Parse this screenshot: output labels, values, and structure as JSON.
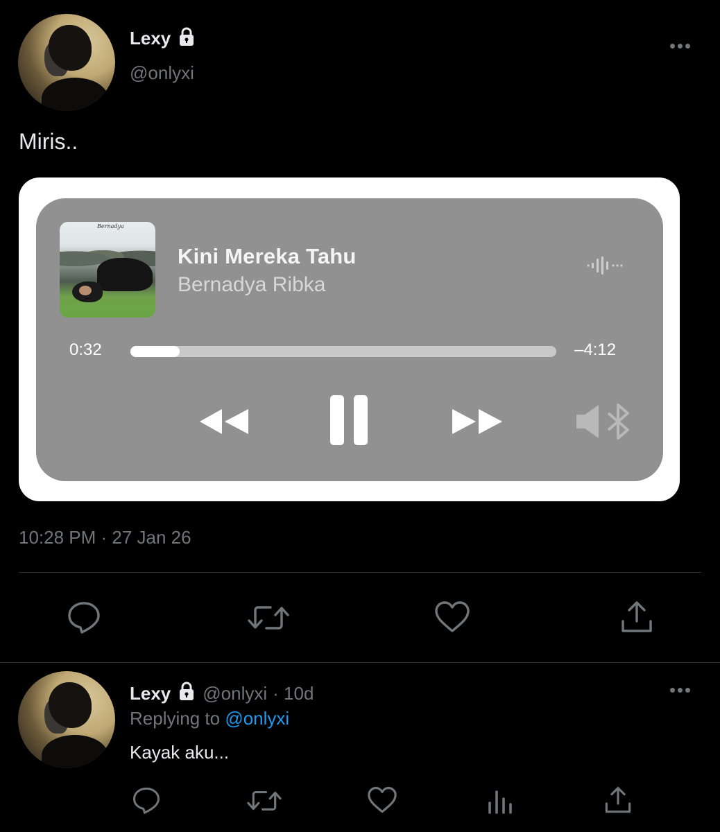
{
  "tweet": {
    "display_name": "Lexy",
    "handle": "@onlyxi",
    "text": "Miris..",
    "timestamp": "10:28 PM · 27 Jan 26",
    "actions": [
      "reply-icon",
      "retweet-icon",
      "like-icon",
      "share-icon"
    ]
  },
  "player": {
    "album_caption": "Bernadya",
    "title": "Kini Mereka Tahu",
    "artist": "Bernadya Ribka",
    "elapsed": "0:32",
    "remaining": "–4:12",
    "progress_fraction": 0.115,
    "controls": [
      "rewind-icon",
      "pause-icon",
      "fast-forward-icon",
      "bluetooth-speaker-icon"
    ]
  },
  "reply": {
    "display_name": "Lexy",
    "handle": "@onlyxi",
    "age": "· 10d",
    "replying_prefix": "Replying to",
    "replying_to": "@onlyxi",
    "text": "Kayak aku...",
    "actions": [
      "reply-icon",
      "retweet-icon",
      "like-icon",
      "analytics-icon",
      "share-icon"
    ]
  },
  "colors": {
    "background": "#000000",
    "muted": "#71767b",
    "link": "#1d9bf0",
    "player_bg": "#919191"
  }
}
